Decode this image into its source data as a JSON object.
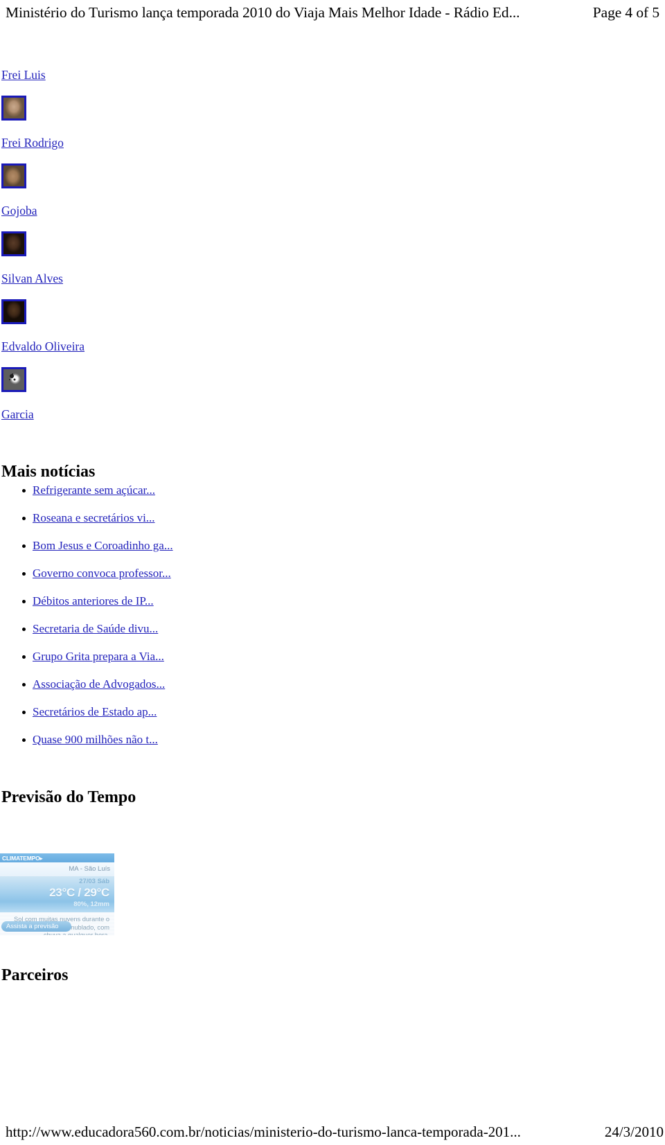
{
  "print_header": {
    "title": "Ministério do Turismo lança temporada 2010 do Viaja Mais Melhor Idade - Rádio Ed...",
    "page_indicator": "Page 4 of 5"
  },
  "people": [
    {
      "name": "Frei Luis",
      "thumb_icon": "portrait-photo-thumbnail"
    },
    {
      "name": "Frei Rodrigo",
      "thumb_icon": "portrait-photo-thumbnail"
    },
    {
      "name": "Gojoba",
      "thumb_icon": "portrait-photo-thumbnail"
    },
    {
      "name": "Silvan Alves",
      "thumb_icon": "portrait-photo-thumbnail"
    },
    {
      "name": "Edvaldo Oliveira",
      "thumb_icon": "soccer-ball-thumbnail"
    },
    {
      "name": "Garcia",
      "thumb_icon": null
    }
  ],
  "news_section": {
    "heading": "Mais notícias",
    "items": [
      "Refrigerante sem açúcar...",
      "Roseana e secretários vi...",
      "Bom Jesus e Coroadinho ga...",
      "Governo convoca professor...",
      "Débitos anteriores de IP...",
      "Secretaria de Saúde divu...",
      "Grupo Grita prepara a Via...",
      "Associação de Advogados...",
      "Secretários de Estado ap...",
      "Quase 900 milhões não t..."
    ]
  },
  "weather_section": {
    "heading": "Previsão do Tempo",
    "widget": {
      "brand": "CLIMATEMPO▸",
      "city": "MA - São Luís",
      "date": "27/03 Sáb",
      "temperatures": "23°C / 29°C",
      "rain": "80%,  12mm",
      "forecast": "Sol com muitas nuvens durante o dia. Períodos de nublado, com chuva a qualquer hora.",
      "cta_label": "Assista a previsão"
    }
  },
  "partners_section": {
    "heading": "Parceiros"
  },
  "print_footer": {
    "url": "http://www.educadora560.com.br/noticias/ministerio-do-turismo-lanca-temporada-201...",
    "date": "24/3/2010"
  },
  "colors": {
    "link": "#2222bb",
    "thumb_border": "#1a1ab8",
    "weather_brandbar": "#65abdf",
    "weather_panel": "#8cc3e8"
  }
}
